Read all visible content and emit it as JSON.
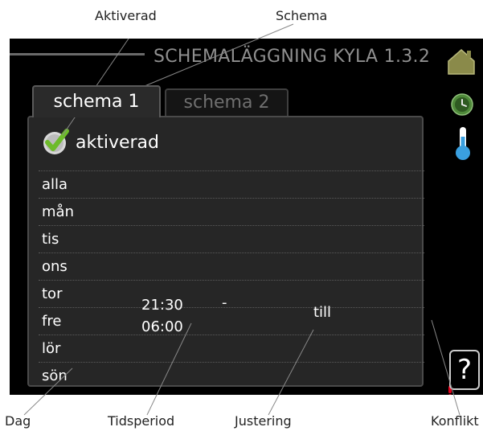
{
  "callouts": {
    "aktiverad": "Aktiverad",
    "schema": "Schema",
    "dag": "Dag",
    "tidsperiod": "Tidsperiod",
    "justering": "Justering",
    "konflikt": "Konflikt"
  },
  "screen": {
    "title": "SCHEMALÄGGNING KYLA 1.3.2",
    "tabs": [
      {
        "label": "schema 1",
        "selected": true
      },
      {
        "label": "schema 2",
        "selected": false
      }
    ],
    "activated": {
      "label": "aktiverad",
      "checked": true
    },
    "days": [
      "alla",
      "mån",
      "tis",
      "ons",
      "tor",
      "fre",
      "lör",
      "sön"
    ],
    "period": {
      "start": "21:30",
      "separator": "-",
      "end": "06:00"
    },
    "adjustment": "till",
    "help_label": "?",
    "side_icons": [
      "house-icon",
      "clock-icon",
      "thermometer-icon"
    ]
  },
  "colors": {
    "screen_bg": "#000000",
    "panel_bg": "#262626",
    "check_green": "#6dbb2a",
    "conflict_red": "#e0001a",
    "house_olive": "#8a8a4a",
    "clock_green": "#4f8a3a",
    "thermo_blue": "#3aa0e0"
  }
}
